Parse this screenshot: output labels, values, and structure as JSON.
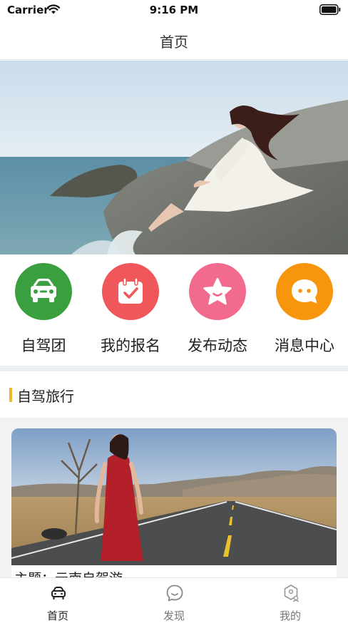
{
  "status_bar": {
    "carrier": "Carrier",
    "time": "9:16 PM",
    "wifi_icon": "wifi-icon",
    "battery_icon": "battery-full-icon"
  },
  "nav": {
    "title": "首页"
  },
  "banner": {
    "image": "woman-in-white-dress-on-seaside-rock-photo"
  },
  "quick_menu": [
    {
      "label": "自驾团",
      "icon": "car-icon",
      "color": "#3aa03f"
    },
    {
      "label": "我的报名",
      "icon": "calendar-check-icon",
      "color": "#f0575a"
    },
    {
      "label": "发布动态",
      "icon": "star-icon",
      "color": "#f26b8f"
    },
    {
      "label": "消息中心",
      "icon": "chat-bubble-icon",
      "color": "#f7950d"
    }
  ],
  "section": {
    "title": "自驾旅行",
    "accent_color": "#f2b234"
  },
  "trip_card": {
    "image": "woman-in-red-dress-on-highway-photo",
    "caption": "主题：云南自驾游"
  },
  "tab_bar": {
    "tabs": [
      {
        "label": "首页",
        "icon": "car-icon",
        "active": true
      },
      {
        "label": "发现",
        "icon": "smile-bubble-icon",
        "active": false
      },
      {
        "label": "我的",
        "icon": "user-badge-icon",
        "active": false
      }
    ]
  }
}
